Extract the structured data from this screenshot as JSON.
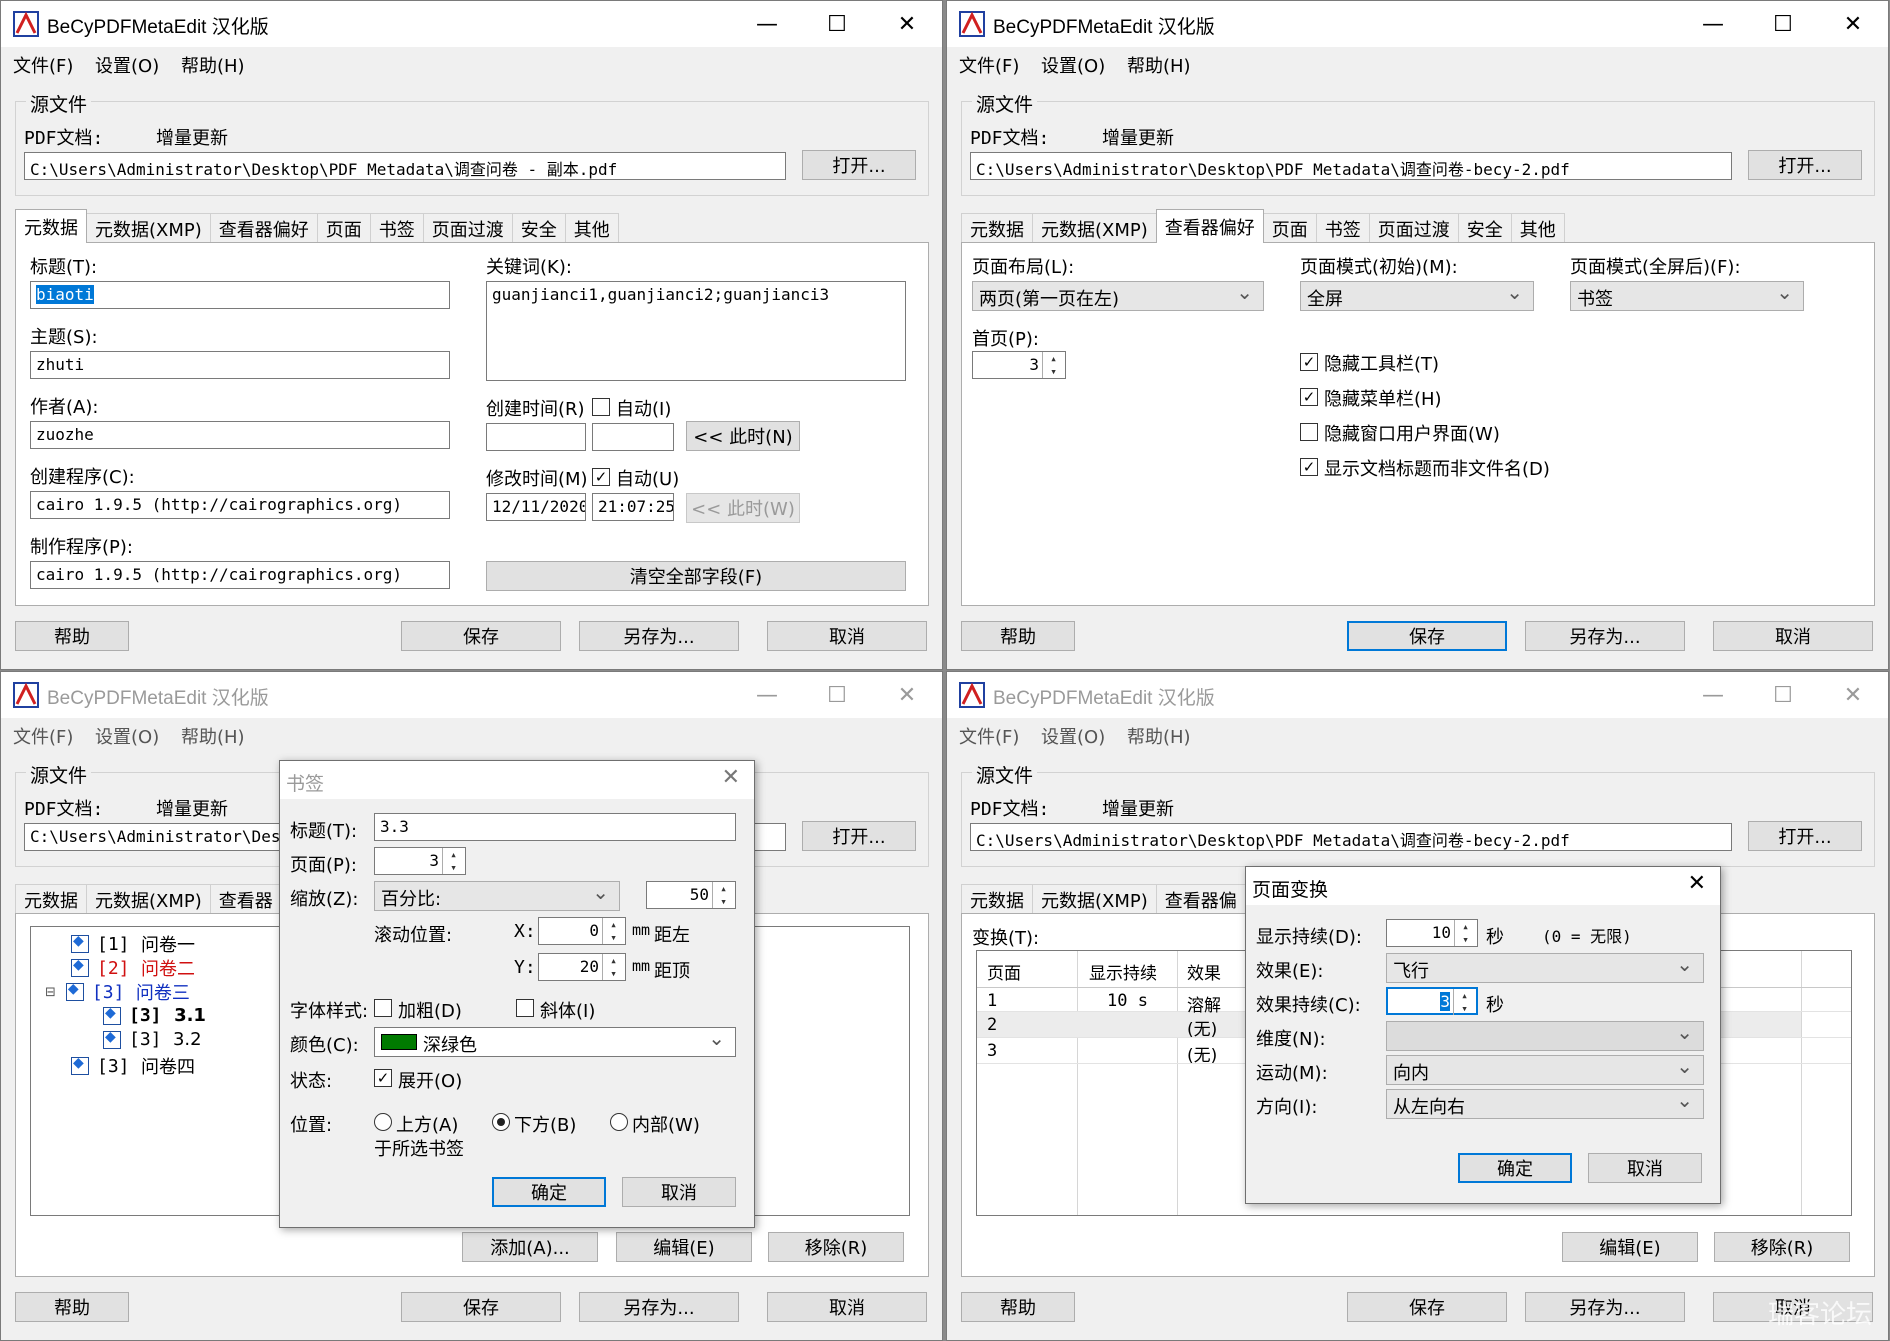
{
  "app": {
    "title": "BeCyPDFMetaEdit 汉化版"
  },
  "menus": [
    "文件(F)",
    "设置(O)",
    "帮助(H)"
  ],
  "source": {
    "group": "源文件",
    "pdf_label": "PDF文档:",
    "mode": "增量更新",
    "open_button": "打开...",
    "path1": "C:\\Users\\Administrator\\Desktop\\PDF Metadata\\调查问卷 - 副本.pdf",
    "path2": "C:\\Users\\Administrator\\Desktop\\PDF Metadata\\调查问卷-becy-2.pdf",
    "path3": "C:\\Users\\Administrator\\Desk"
  },
  "tabs": [
    "元数据",
    "元数据(XMP)",
    "查看器偏好",
    "页面",
    "书签",
    "页面过渡",
    "安全",
    "其他"
  ],
  "tabs_clipped_bookmark": [
    "元数据",
    "元数据(XMP)",
    "查看器"
  ],
  "tabs_clipped_transition": [
    "元数据",
    "元数据(XMP)",
    "查看器偏"
  ],
  "footer": {
    "help": "帮助",
    "save": "保存",
    "save_as": "另存为...",
    "cancel": "取消"
  },
  "metadata": {
    "title_label": "标题(T):",
    "title_value": "biaoti",
    "subject_label": "主题(S):",
    "subject_value": "zhuti",
    "author_label": "作者(A):",
    "author_value": "zuozhe",
    "creator_label": "创建程序(C):",
    "creator_value": "cairo 1.9.5 (http://cairographics.org)",
    "producer_label": "制作程序(P):",
    "producer_value": "cairo 1.9.5 (http://cairographics.org)",
    "keywords_label": "关键词(K):",
    "keywords_value": "guanjianci1,guanjianci2;guanjianci3",
    "created_label": "创建时间(R)",
    "created_auto": "自动(I)",
    "now_button": "<< 此时(N)",
    "modified_label": "修改时间(M)",
    "modified_auto": "自动(U)",
    "modified_date": "12/11/2020",
    "modified_time": "21:07:25",
    "now_button2": "<< 此时(W)",
    "clear_button": "清空全部字段(F)"
  },
  "viewer": {
    "layout_label": "页面布局(L):",
    "layout_value": "两页(第一页在左)",
    "mode_label": "页面模式(初始)(M):",
    "mode_value": "全屏",
    "fsmode_label": "页面模式(全屏后)(F):",
    "fsmode_value": "书签",
    "first_label": "首页(P):",
    "first_value": "3",
    "hide_toolbar": "隐藏工具栏(T)",
    "hide_menubar": "隐藏菜单栏(H)",
    "hide_ui": "隐藏窗口用户界面(W)",
    "show_title": "显示文档标题而非文件名(D)"
  },
  "bookmarks": {
    "items": [
      {
        "num": "[1]",
        "label": "问卷一",
        "color": "#000000"
      },
      {
        "num": "[2]",
        "label": "问卷二",
        "color": "#d01010"
      },
      {
        "num": "[3]",
        "label": "问卷三",
        "color": "#1030c0"
      },
      {
        "num": "[3]",
        "label": "3.1",
        "color": "#000000"
      },
      {
        "num": "[3]",
        "label": "3.2",
        "color": "#000000"
      },
      {
        "num": "[3]",
        "label": "问卷四",
        "color": "#000000"
      }
    ],
    "add": "添加(A)...",
    "edit": "编辑(E)",
    "remove": "移除(R)"
  },
  "bm_dialog": {
    "title": "书签",
    "title_label": "标题(T):",
    "title_value": "3.3",
    "page_label": "页面(P):",
    "page_value": "3",
    "zoom_label": "缩放(Z):",
    "zoom_mode": "百分比:",
    "zoom_value": "50",
    "scroll_label": "滚动位置:",
    "x_label": "X:",
    "x_value": "0",
    "x_unit": "mm",
    "x_desc": "距左",
    "y_label": "Y:",
    "y_value": "20",
    "y_unit": "mm",
    "y_desc": "距顶",
    "font_label": "字体样式:",
    "bold": "加粗(D)",
    "italic": "斜体(I)",
    "color_label": "颜色(C):",
    "color_value": "深绿色",
    "color_swatch": "#007a00",
    "state_label": "状态:",
    "expand": "展开(O)",
    "pos_label": "位置:",
    "above": "上方(A)",
    "below": "下方(B)",
    "inside": "内部(W)",
    "pos_note": "于所选书签",
    "ok": "确定",
    "cancel": "取消"
  },
  "transition": {
    "list_label": "变换(T):",
    "headers": [
      "页面",
      "显示持续",
      "效果"
    ],
    "rows": [
      {
        "page": "1",
        "dur": "10 s",
        "effect": "溶解"
      },
      {
        "page": "2",
        "dur": "",
        "effect": "(无)"
      },
      {
        "page": "3",
        "dur": "",
        "effect": "(无)"
      }
    ],
    "edit": "编辑(E)",
    "remove": "移除(R)"
  },
  "tr_dialog": {
    "title": "页面变换",
    "dur_label": "显示持续(D):",
    "dur_value": "10",
    "dur_unit": "秒",
    "dur_note": "(0 = 无限)",
    "effect_label": "效果(E):",
    "effect_value": "飞行",
    "edur_label": "效果持续(C):",
    "edur_value": "3",
    "edur_unit": "秒",
    "dim_label": "维度(N):",
    "motion_label": "运动(M):",
    "motion_value": "向内",
    "dir_label": "方向(I):",
    "dir_value": "从左向右",
    "ok": "确定",
    "cancel": "取消"
  },
  "watermark": "瑞客论坛"
}
